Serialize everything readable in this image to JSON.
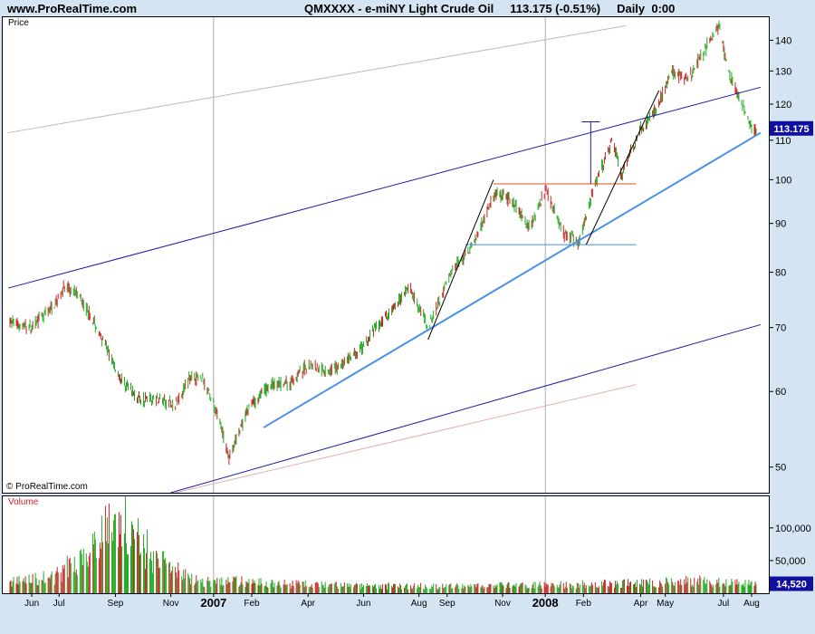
{
  "header": {
    "site": "www.ProRealTime.com",
    "title": "QMXXXX - e-miNY Light Crude Oil     113.175 (-0.51%)     Daily  0:00"
  },
  "price_panel": {
    "label": "Price",
    "copyright": "© ProRealTime.com"
  },
  "volume_panel": {
    "label": "Volume"
  },
  "colors": {
    "background": "#d4e4f2",
    "up": "#22aa22",
    "down": "#cc2222",
    "trendline_light": "#4a90e8",
    "channel": "#1a1aa0",
    "resistance": "#e05020",
    "support": "#4a90e8",
    "last_price_box": "#1010a0"
  },
  "chart_data": [
    {
      "type": "candlestick",
      "title": "QMXXXX - e-miNY Light Crude Oil",
      "last_price": "113.175",
      "change": "(-0.51%)",
      "y_scale": "log",
      "ylim": [
        47,
        148
      ],
      "y_ticks": [
        50,
        60,
        70,
        80,
        90,
        100,
        110,
        120,
        130,
        140
      ],
      "y_tick_labels": [
        "50",
        "60",
        "70",
        "80",
        "90",
        "100",
        "110",
        "120",
        "130",
        "140"
      ],
      "x_tick_labels": [
        "Jun",
        "Jul",
        "Sep",
        "Nov",
        "2007",
        "Feb",
        "Apr",
        "Jun",
        "Aug",
        "Sep",
        "Nov",
        "2008",
        "Feb",
        "Apr",
        "May",
        "Jul",
        "Aug"
      ],
      "price_path": [
        {
          "date": "2006-05-20",
          "close": 71
        },
        {
          "date": "2006-06-15",
          "close": 70
        },
        {
          "date": "2006-07-10",
          "close": 74
        },
        {
          "date": "2006-07-20",
          "close": 77
        },
        {
          "date": "2006-08-05",
          "close": 76
        },
        {
          "date": "2006-08-25",
          "close": 70
        },
        {
          "date": "2006-09-20",
          "close": 62
        },
        {
          "date": "2006-10-10",
          "close": 59
        },
        {
          "date": "2006-10-30",
          "close": 59
        },
        {
          "date": "2006-11-20",
          "close": 58
        },
        {
          "date": "2006-12-05",
          "close": 62
        },
        {
          "date": "2006-12-20",
          "close": 62
        },
        {
          "date": "2007-01-05",
          "close": 57
        },
        {
          "date": "2007-01-18",
          "close": 51
        },
        {
          "date": "2007-02-10",
          "close": 58
        },
        {
          "date": "2007-03-05",
          "close": 61
        },
        {
          "date": "2007-03-25",
          "close": 61
        },
        {
          "date": "2007-04-15",
          "close": 64
        },
        {
          "date": "2007-05-10",
          "close": 63
        },
        {
          "date": "2007-06-10",
          "close": 66
        },
        {
          "date": "2007-07-15",
          "close": 73
        },
        {
          "date": "2007-08-05",
          "close": 77
        },
        {
          "date": "2007-08-25",
          "close": 70
        },
        {
          "date": "2007-09-20",
          "close": 80
        },
        {
          "date": "2007-10-15",
          "close": 86
        },
        {
          "date": "2007-11-07",
          "close": 97
        },
        {
          "date": "2007-11-25",
          "close": 95
        },
        {
          "date": "2007-12-15",
          "close": 89
        },
        {
          "date": "2008-01-02",
          "close": 98
        },
        {
          "date": "2008-01-20",
          "close": 88
        },
        {
          "date": "2008-02-07",
          "close": 86
        },
        {
          "date": "2008-02-25",
          "close": 99
        },
        {
          "date": "2008-03-15",
          "close": 110
        },
        {
          "date": "2008-03-25",
          "close": 101
        },
        {
          "date": "2008-04-15",
          "close": 113
        },
        {
          "date": "2008-05-01",
          "close": 118
        },
        {
          "date": "2008-05-20",
          "close": 130
        },
        {
          "date": "2008-06-05",
          "close": 127
        },
        {
          "date": "2008-06-25",
          "close": 137
        },
        {
          "date": "2008-07-10",
          "close": 145
        },
        {
          "date": "2008-07-20",
          "close": 130
        },
        {
          "date": "2008-08-01",
          "close": 122
        },
        {
          "date": "2008-08-15",
          "close": 113
        }
      ],
      "drawn_lines": [
        {
          "name": "channel-upper-outer",
          "color": "#bbbbbb",
          "points": [
            [
              "2006-05-20",
              112
            ],
            [
              "2008-03-30",
              145
            ]
          ]
        },
        {
          "name": "channel-upper",
          "color": "#1a1aa0",
          "points": [
            [
              "2006-05-20",
              77
            ],
            [
              "2008-08-25",
              125
            ]
          ]
        },
        {
          "name": "channel-lower",
          "color": "#1a1aa0",
          "points": [
            [
              "2006-11-15",
              47
            ],
            [
              "2008-08-25",
              70.5
            ]
          ]
        },
        {
          "name": "channel-lower-faint",
          "color": "#e0b0b0",
          "points": [
            [
              "2006-11-20",
              47
            ],
            [
              "2008-04-10",
              61
            ]
          ]
        },
        {
          "name": "support-trendline",
          "color": "#4a90e8",
          "points": [
            [
              "2007-02-25",
              55
            ],
            [
              "2008-08-25",
              112
            ]
          ]
        },
        {
          "name": "support-horizontal",
          "color": "#4a90e8",
          "points": [
            [
              "2007-10-05",
              85.5
            ],
            [
              "2008-04-10",
              85.5
            ]
          ]
        },
        {
          "name": "resistance-horizontal",
          "color": "#e05020",
          "points": [
            [
              "2007-11-05",
              99
            ],
            [
              "2008-04-10",
              99
            ]
          ]
        },
        {
          "name": "flag-pole-1",
          "color": "#000000",
          "points": [
            [
              "2007-08-25",
              68
            ],
            [
              "2007-11-05",
              100
            ]
          ]
        },
        {
          "name": "flag-pole-2",
          "color": "#000000",
          "points": [
            [
              "2008-02-15",
              85.5
            ],
            [
              "2008-05-05",
              124
            ]
          ]
        },
        {
          "name": "measured-move",
          "color": "#1a1aa0",
          "points": [
            [
              "2008-02-20",
              99
            ],
            [
              "2008-02-20",
              115
            ]
          ]
        }
      ]
    },
    {
      "type": "bar",
      "title": "Volume",
      "last_value": "14,520",
      "ylim": [
        0,
        140000
      ],
      "y_ticks": [
        50000,
        100000
      ],
      "y_tick_labels": [
        "50,000",
        "100,000"
      ],
      "volume_path": [
        {
          "date": "2006-05-20",
          "v": 18000
        },
        {
          "date": "2006-07-10",
          "v": 26000
        },
        {
          "date": "2006-08-10",
          "v": 60000
        },
        {
          "date": "2006-08-25",
          "v": 95000
        },
        {
          "date": "2006-09-10",
          "v": 110000
        },
        {
          "date": "2006-09-25",
          "v": 120000
        },
        {
          "date": "2006-10-10",
          "v": 85000
        },
        {
          "date": "2006-10-25",
          "v": 62000
        },
        {
          "date": "2006-11-15",
          "v": 40000
        },
        {
          "date": "2006-12-20",
          "v": 18000
        },
        {
          "date": "2007-01-20",
          "v": 20000
        },
        {
          "date": "2007-03-01",
          "v": 16000
        },
        {
          "date": "2007-06-01",
          "v": 12000
        },
        {
          "date": "2007-10-01",
          "v": 11000
        },
        {
          "date": "2008-02-01",
          "v": 14000
        },
        {
          "date": "2008-05-01",
          "v": 17000
        },
        {
          "date": "2008-06-15",
          "v": 20000
        },
        {
          "date": "2008-08-15",
          "v": 14520
        }
      ]
    }
  ]
}
